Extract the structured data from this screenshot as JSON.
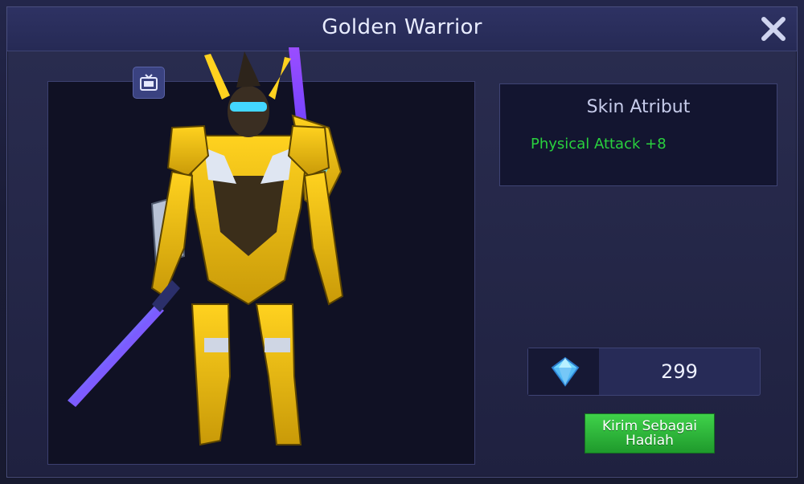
{
  "dialog": {
    "title": "Golden Warrior"
  },
  "preview": {
    "video_icon": "tv-icon",
    "hero_image": "golden-warrior-skin-art"
  },
  "attributes": {
    "heading": "Skin Atribut",
    "items": [
      "Physical Attack +8"
    ],
    "value_color": "#29d13e"
  },
  "price": {
    "icon": "diamond-icon",
    "amount": "299"
  },
  "gift_button": {
    "line1": "Kirim Sebagai",
    "line2": "Hadiah",
    "color": "#2bb83a"
  },
  "close_icon": "close-icon"
}
